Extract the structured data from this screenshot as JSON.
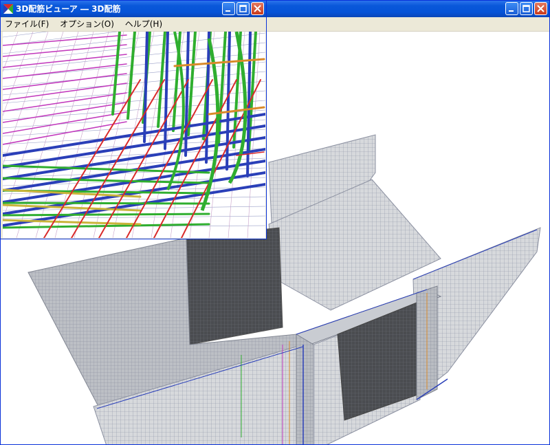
{
  "back_window": {
    "title": "",
    "menu": []
  },
  "front_window": {
    "title": "3D配筋ビューア ― 3D配筋",
    "menu": [
      {
        "label": "ファイル(F)"
      },
      {
        "label": "オプション(O)"
      },
      {
        "label": "ヘルプ(H)"
      }
    ]
  },
  "icons": {
    "app": "app-icon",
    "minimize": "minimize-icon",
    "maximize": "maximize-icon",
    "close": "close-icon"
  },
  "colors": {
    "titlebar": "#0a58d9",
    "rebar_blue": "#2a3fb8",
    "rebar_green": "#2fae2f",
    "rebar_magenta": "#c23bbd",
    "rebar_red": "#d92a2a",
    "concrete": "#9aa0a8"
  }
}
